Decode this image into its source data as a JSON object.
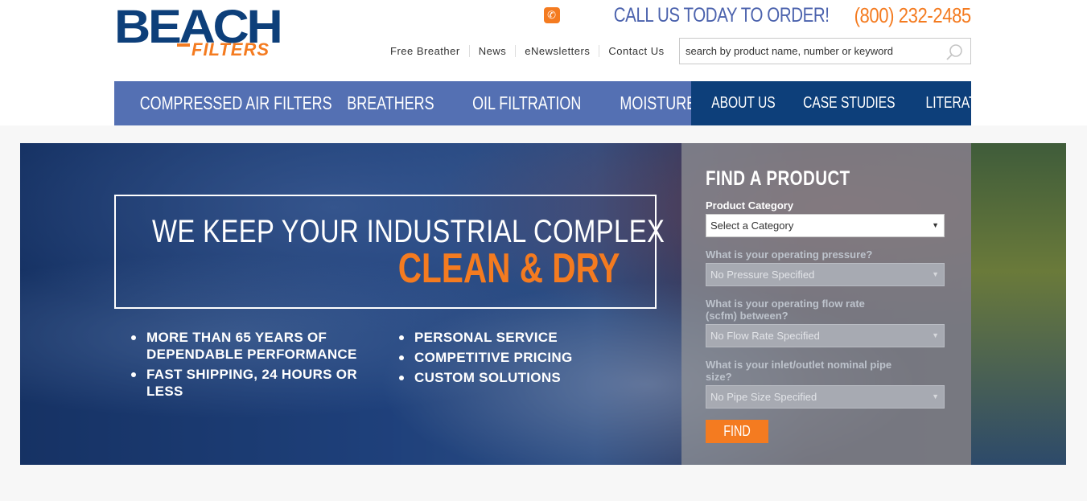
{
  "logo": {
    "word": "BEACH",
    "sub": "FILTERS"
  },
  "header": {
    "call_label": "CALL US TODAY TO ORDER!",
    "phone": "(800) 232-2485",
    "utility_links": [
      "Free Breather",
      "News",
      "eNewsletters",
      "Contact Us"
    ],
    "search_placeholder": "search by product name, number or keyword"
  },
  "nav": {
    "primary": [
      "COMPRESSED AIR FILTERS",
      "BREATHERS",
      "OIL FILTRATION",
      "MOISTURE CONTROL"
    ],
    "secondary": [
      "ABOUT US",
      "CASE STUDIES",
      "LITERATURE"
    ]
  },
  "hero": {
    "headline_1": "WE KEEP YOUR INDUSTRIAL COMPLEX",
    "headline_2": "CLEAN & DRY",
    "bullets_left": [
      "MORE THAN 65 YEARS OF DEPENDABLE PERFORMANCE",
      "FAST SHIPPING, 24 HOURS OR LESS"
    ],
    "bullets_right": [
      "PERSONAL SERVICE",
      "COMPETITIVE PRICING",
      "CUSTOM SOLUTIONS"
    ]
  },
  "finder": {
    "title": "FIND A PRODUCT",
    "category_label": "Product Category",
    "category_value": "Select a Category",
    "pressure_label": "What is your operating pressure?",
    "pressure_value": "No Pressure Specified",
    "flow_label": "What is your operating flow rate (scfm) between?",
    "flow_value": "No Flow Rate Specified",
    "pipe_label": "What is your inlet/outlet nominal pipe size?",
    "pipe_value": "No Pipe Size Specified",
    "button": "FIND"
  },
  "colors": {
    "accent": "#f47b20",
    "nav_primary": "#5470b3",
    "nav_secondary": "#0d3f7a"
  },
  "icons": {
    "phone": "phone-icon",
    "search": "search-icon",
    "caret": "chevron-down-icon"
  }
}
